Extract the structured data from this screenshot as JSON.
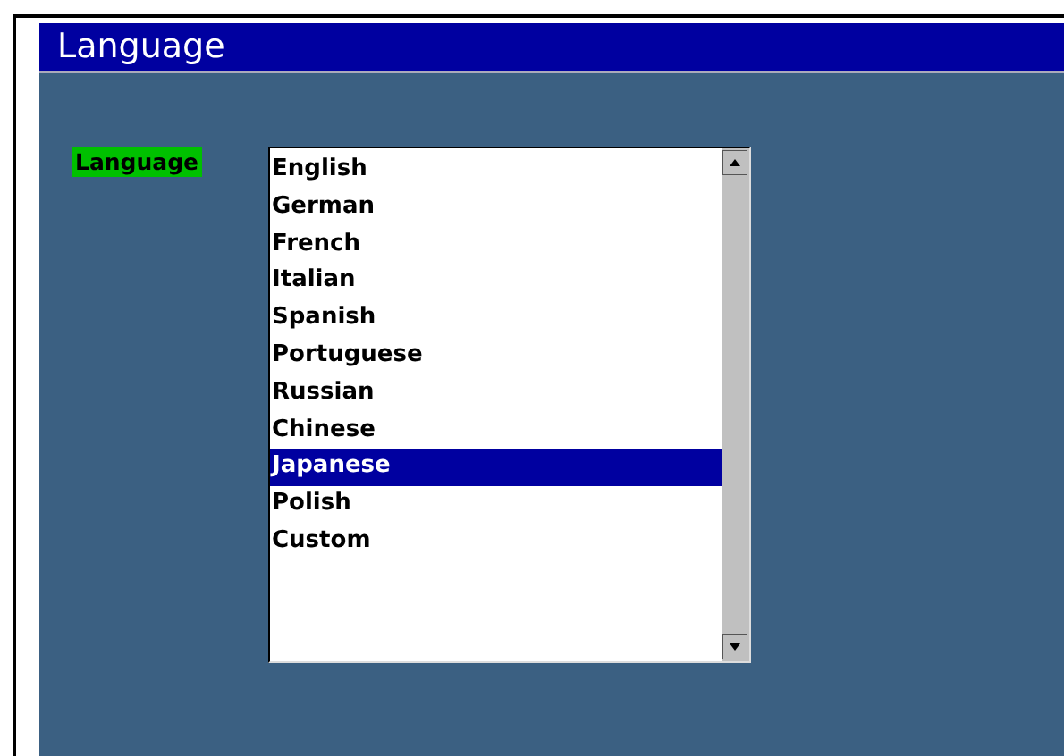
{
  "window": {
    "title": "Language"
  },
  "field": {
    "label": "Language"
  },
  "list": {
    "items": [
      {
        "label": "English",
        "selected": false
      },
      {
        "label": "German",
        "selected": false
      },
      {
        "label": "French",
        "selected": false
      },
      {
        "label": "Italian",
        "selected": false
      },
      {
        "label": "Spanish",
        "selected": false
      },
      {
        "label": "Portuguese",
        "selected": false
      },
      {
        "label": "Russian",
        "selected": false
      },
      {
        "label": "Chinese",
        "selected": false
      },
      {
        "label": "Japanese",
        "selected": true
      },
      {
        "label": "Polish",
        "selected": false
      },
      {
        "label": "Custom",
        "selected": false
      }
    ]
  }
}
